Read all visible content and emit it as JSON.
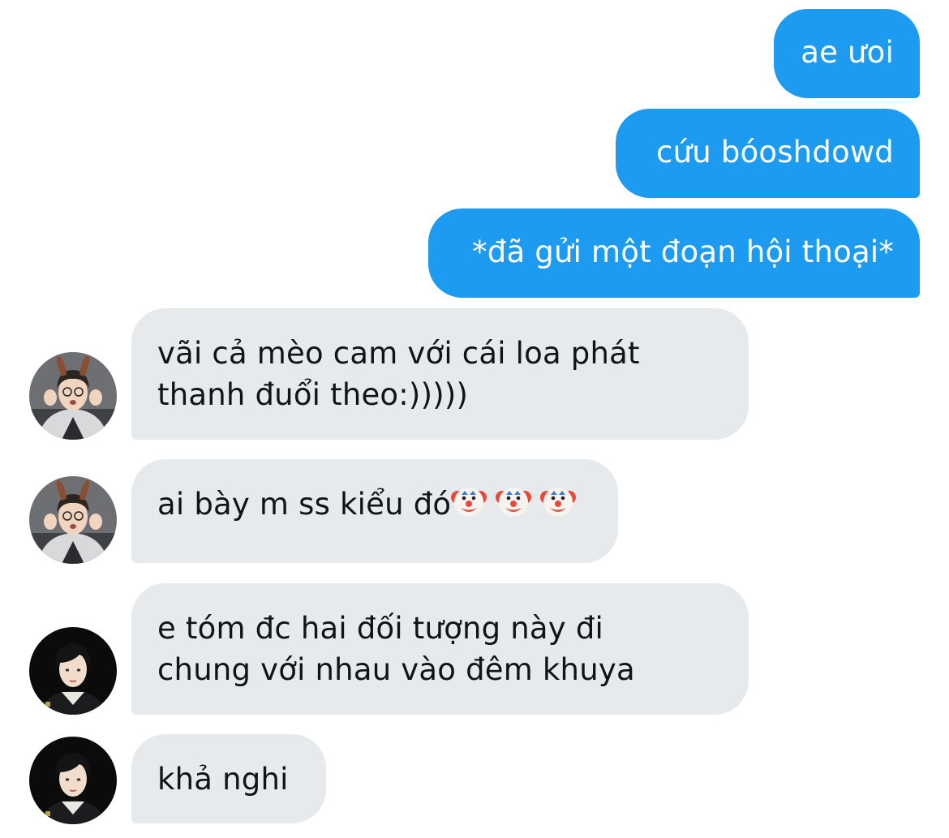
{
  "conversation": {
    "messages": [
      {
        "sender": "me",
        "text": "ae ưoi"
      },
      {
        "sender": "me",
        "text": "cứu bóoshdowd"
      },
      {
        "sender": "me",
        "text": "*đã gửi một đoạn hội thoại*"
      },
      {
        "sender": "friend1",
        "lines": [
          "vãi cả mèo cam với cái loa phát",
          "thanh đuổi theo:)))))"
        ]
      },
      {
        "sender": "friend1",
        "text": "ai bày m ss kiểu đó",
        "emoji": "clown-face-emoji",
        "emoji_count": 3
      },
      {
        "sender": "friend2",
        "lines": [
          "e tóm đc hai đối tượng này đi",
          "chung với nhau vào đêm khuya"
        ]
      },
      {
        "sender": "friend2",
        "text": "khả nghi"
      }
    ]
  },
  "colors": {
    "outgoing_bubble": "#1d9bf0",
    "incoming_bubble": "#e7eaed",
    "incoming_text": "#0f1419",
    "outgoing_text": "#ffffff"
  },
  "avatars": {
    "friend1": {
      "icon": "person-with-bunny-ears-avatar"
    },
    "friend2": {
      "icon": "person-dark-hair-avatar"
    }
  }
}
